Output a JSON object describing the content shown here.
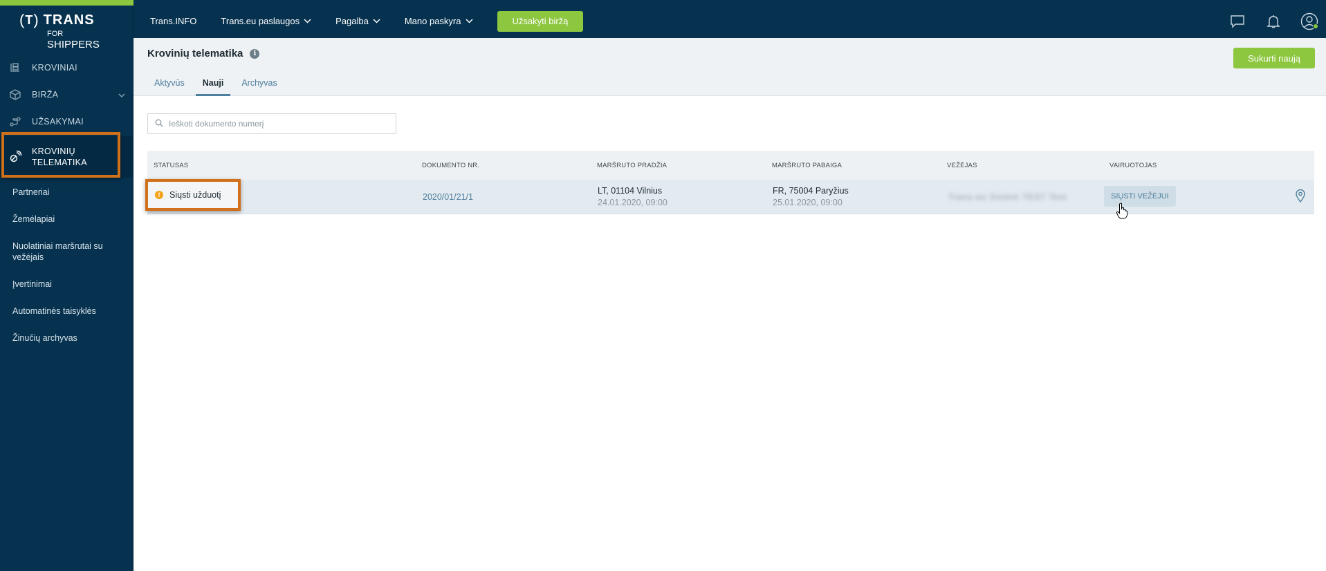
{
  "logo": {
    "bracket_letter": "T",
    "brand": "TRANS",
    "for": "FOR",
    "sub": "SHIPPERS"
  },
  "sidebar": {
    "items": [
      {
        "label": "KROVINIAI",
        "icon": "cargo-icon"
      },
      {
        "label": "BIRŽA",
        "icon": "box-icon",
        "has_dropdown": true
      },
      {
        "label": "UŽSAKYMAI",
        "icon": "route-icon"
      },
      {
        "label": "KROVINIŲ TELEMATIKA",
        "line1": "KROVINIŲ",
        "line2": "TELEMATIKA",
        "icon": "satellite-icon",
        "active": true
      }
    ],
    "subitems": [
      {
        "label": "Partneriai"
      },
      {
        "label": "Žemėlapiai"
      },
      {
        "label": "Nuolatiniai maršrutai su vežėjais"
      },
      {
        "label": "Įvertinimai"
      },
      {
        "label": "Automatinės taisyklės"
      },
      {
        "label": "Žinučių archyvas"
      }
    ]
  },
  "topbar": {
    "nav": [
      {
        "label": "Trans.INFO"
      },
      {
        "label": "Trans.eu paslaugos",
        "dropdown": true
      },
      {
        "label": "Pagalba",
        "dropdown": true
      },
      {
        "label": "Mano paskyra",
        "dropdown": true
      }
    ],
    "cta_label": "Užsakyti biržą",
    "icons": [
      "chat-icon",
      "bell-icon",
      "user-icon"
    ]
  },
  "page": {
    "title": "Krovinių telematika",
    "new_button": "Sukurti naują",
    "tabs": [
      {
        "label": "Aktyvūs",
        "active": false
      },
      {
        "label": "Nauji",
        "active": true
      },
      {
        "label": "Archyvas",
        "active": false
      }
    ],
    "search": {
      "placeholder": "Ieškoti dokumento numerį",
      "value": ""
    }
  },
  "table": {
    "columns": [
      "STATUSAS",
      "DOKUMENTO NR.",
      "MARŠRUTO PRADŽIA",
      "MARŠRUTO PABAIGA",
      "VEŽĖJAS",
      "VAIRUOTOJAS"
    ],
    "rows": [
      {
        "status": "Siųsti užduotį",
        "document": "2020/01/21/1",
        "start": {
          "place": "LT, 01104 Vilnius",
          "date": "24.01.2020, 09:00"
        },
        "end": {
          "place": "FR, 75004 Paryžius",
          "date": "25.01.2020, 09:00"
        },
        "carrier": "Trans-eu Sistem TEST Test",
        "driver_action": "SIŲSTI VEŽĖJUI"
      }
    ]
  },
  "colors": {
    "sidebar_bg": "#06324f",
    "accent_green": "#8dc63f",
    "highlight_orange": "#d0701a",
    "link_blue": "#4f7f9e",
    "warning": "#f4a31b"
  }
}
